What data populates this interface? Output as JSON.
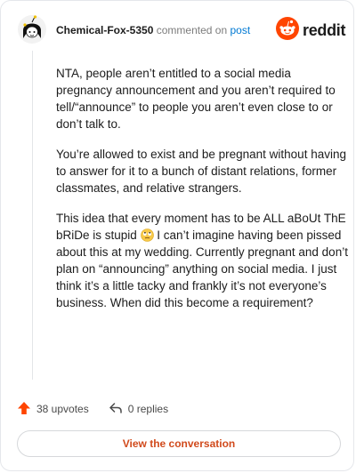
{
  "header": {
    "username": "Chemical-Fox-5350",
    "commented_text": "commented on",
    "post_link": "post",
    "brand": "reddit"
  },
  "comment": {
    "paragraphs": [
      "NTA, people aren’t entitled to a social media pregnancy announcement and you aren’t required to tell/“announce” to people you aren’t even close to or don’t talk to.",
      "You’re allowed to exist and be pregnant without having to answer for it to a bunch of distant relations, former classmates, and relative strangers."
    ],
    "p3_before_emoji": "This idea that every moment has to be ALL aBoUt ThE bRiDe is stupid ",
    "p3_after_emoji": " I can’t imagine having been pissed about this at my wedding. Currently pregnant and don’t plan on “announcing” anything on social media. I just think it’s a little tacky and frankly it’s not everyone’s business. When did this become a requirement?"
  },
  "footer": {
    "upvotes": "38 upvotes",
    "replies": "0 replies",
    "view_button": "View the conversation"
  },
  "colors": {
    "upvote": "#ff4500",
    "link": "#0079d3",
    "button_text": "#d14a1c",
    "reddit_orange": "#ff4500"
  },
  "icons": [
    "avatar",
    "reddit-logo-icon",
    "upvote-arrow-icon",
    "reply-arrow-icon",
    "rolling-eyes-emoji"
  ]
}
